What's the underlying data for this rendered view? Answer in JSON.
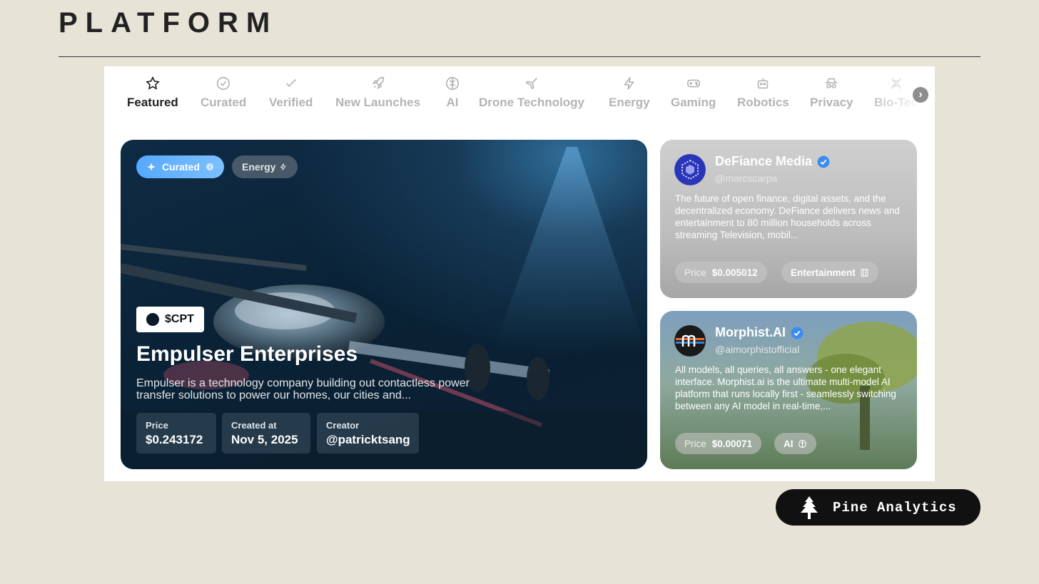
{
  "slide": {
    "title": "PLATFORM"
  },
  "tabs": [
    {
      "label": "Featured",
      "icon": "star-icon",
      "active": true
    },
    {
      "label": "Curated",
      "icon": "check-circle-icon"
    },
    {
      "label": "Verified",
      "icon": "check-icon"
    },
    {
      "label": "New Launches",
      "icon": "rocket-icon"
    },
    {
      "label": "AI",
      "icon": "brain-icon"
    },
    {
      "label": "Drone Technology",
      "icon": "plane-icon"
    },
    {
      "label": "Energy",
      "icon": "bolt-icon"
    },
    {
      "label": "Gaming",
      "icon": "gamepad-icon"
    },
    {
      "label": "Robotics",
      "icon": "robot-icon"
    },
    {
      "label": "Privacy",
      "icon": "incognito-icon"
    },
    {
      "label": "Bio-Tec",
      "icon": "dna-icon"
    }
  ],
  "featured": {
    "badge_curated": "Curated",
    "badge_category": "Energy",
    "ticker": "$CPT",
    "name": "Empulser Enterprises",
    "description": "Empulser is a technology company building out contactless power transfer solutions to power our homes, our cities and...",
    "stats": [
      {
        "label": "Price",
        "value": "$0.243172"
      },
      {
        "label": "Created at",
        "value": "Nov 5, 2025"
      },
      {
        "label": "Creator",
        "value": "@patricktsang"
      }
    ]
  },
  "side_cards": [
    {
      "name": "DeFiance Media",
      "handle": "@marcscarpa",
      "description": "The future of open finance, digital assets, and the decentralized economy. DeFiance delivers news and entertainment to 80 million households across streaming Television, mobil...",
      "price_label": "Price",
      "price": "$0.005012",
      "category": "Entertainment"
    },
    {
      "name": "Morphist.AI",
      "handle": "@aimorphistofficial",
      "description": "All models, all queries, all answers - one elegant interface. Morphist.ai is the ultimate multi-model AI platform that runs locally first - seamlessly switching between any AI model in real-time,...",
      "price_label": "Price",
      "price": "$0.00071",
      "category": "AI"
    }
  ],
  "brand": {
    "name": "Pine Analytics",
    "icon": "pine-tree-icon"
  },
  "colors": {
    "background": "#e8e3d7",
    "accent_blue": "#56a9ff",
    "verified": "#3b8bf5"
  }
}
